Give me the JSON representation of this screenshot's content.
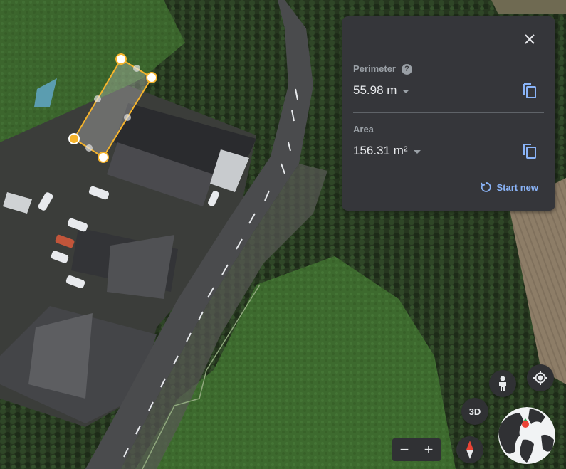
{
  "map": {
    "view": "satellite",
    "measurement_color": "#f6b42c"
  },
  "measure_panel": {
    "close_icon": "close-icon",
    "perimeter": {
      "label": "Perimeter",
      "help_icon": "help-icon",
      "help_glyph": "?",
      "value": "55.98 m",
      "copy_icon": "copy-icon"
    },
    "area": {
      "label": "Area",
      "value": "156.31 m²",
      "copy_icon": "copy-icon"
    },
    "start_new_label": "Start new",
    "start_new_icon": "refresh-icon",
    "accent_color": "#8ab4f8"
  },
  "controls": {
    "pegman_icon": "pegman-icon",
    "my_location_icon": "my-location-icon",
    "three_d_label": "3D",
    "zoom_out_label": "−",
    "zoom_in_label": "+",
    "compass_icon": "compass-icon",
    "globe_icon": "globe-icon"
  }
}
